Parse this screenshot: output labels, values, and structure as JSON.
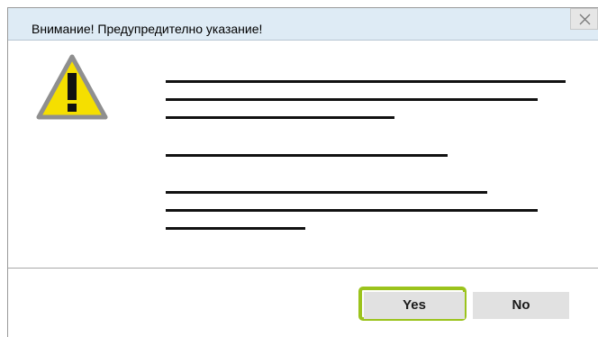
{
  "dialog": {
    "title": "Внимание! Предупредително указание!",
    "close_icon": "close-icon",
    "icon": "warning-triangle-icon",
    "yes_label": "Yes",
    "no_label": "No",
    "focused_button": "Yes"
  },
  "colors": {
    "titlebar_bg": "#deebf5",
    "warning_fill": "#f5df00",
    "focus_ring": "#9bc31c",
    "button_bg": "#e1e1e1"
  }
}
